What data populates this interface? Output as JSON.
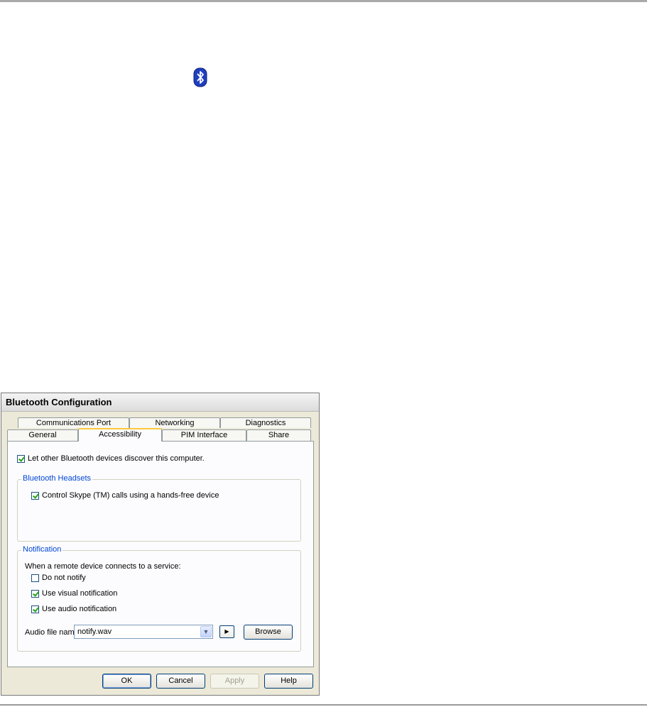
{
  "dialog": {
    "title": "Bluetooth Configuration",
    "tabs_row1": [
      "Communications Port",
      "Networking",
      "Diagnostics"
    ],
    "tabs_row2": [
      "General",
      "Accessibility",
      "PIM Interface",
      "Share"
    ],
    "active_tab": "Accessibility"
  },
  "accessibility": {
    "discover_label": "Let other Bluetooth devices discover this computer.",
    "discover_checked": true,
    "headsets": {
      "title": "Bluetooth Headsets",
      "skype_label": "Control Skype (TM) calls using a hands-free device",
      "skype_checked": true
    },
    "notification": {
      "title": "Notification",
      "intro": "When a remote device connects to a service:",
      "do_not_notify_label": "Do not notify",
      "do_not_notify_checked": false,
      "visual_label": "Use visual notification",
      "visual_checked": true,
      "audio_label": "Use audio notification",
      "audio_checked": true,
      "audio_file_label": "Audio file name:",
      "audio_file_value": "notify.wav",
      "browse_label": "Browse"
    }
  },
  "buttons": {
    "ok": "OK",
    "cancel": "Cancel",
    "apply": "Apply",
    "help": "Help"
  },
  "icons": {
    "bluetooth": "bluetooth-icon",
    "dropdown": "chevron-down-icon",
    "play": "play-icon"
  },
  "colors": {
    "bluetooth_blue": "#1f3fbf",
    "group_title": "#0046d5",
    "active_tab_accent": "#ffc83c",
    "check_green": "#21a121"
  }
}
